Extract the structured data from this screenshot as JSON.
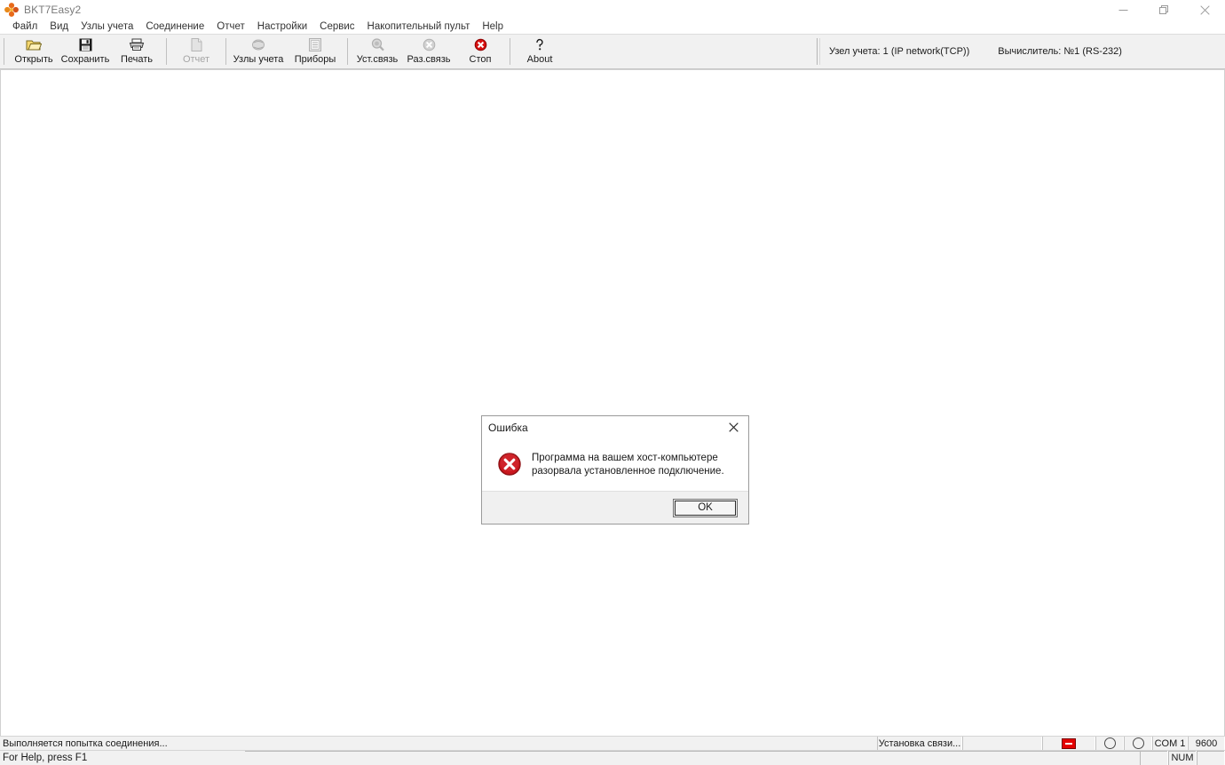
{
  "window": {
    "title": "BKT7Easy2",
    "app_icon": "clover-icon",
    "caption": {
      "minimize": "minimize-icon",
      "restore": "restore-icon",
      "close": "close-icon"
    }
  },
  "menubar": {
    "items": [
      {
        "label": "Файл",
        "name": "menu-file"
      },
      {
        "label": "Вид",
        "name": "menu-view"
      },
      {
        "label": "Узлы учета",
        "name": "menu-accounting-nodes"
      },
      {
        "label": "Соединение",
        "name": "menu-connection"
      },
      {
        "label": "Отчет",
        "name": "menu-report"
      },
      {
        "label": "Настройки",
        "name": "menu-settings"
      },
      {
        "label": "Сервис",
        "name": "menu-service"
      },
      {
        "label": "Накопительный пульт",
        "name": "menu-accumulator-console"
      },
      {
        "label": "Help",
        "name": "menu-help"
      }
    ]
  },
  "toolbar": {
    "buttons": [
      {
        "label": "Открыть",
        "icon": "open-folder-icon",
        "disabled": false
      },
      {
        "label": "Сохранить",
        "icon": "save-disk-icon",
        "disabled": false
      },
      {
        "label": "Печать",
        "icon": "print-icon",
        "disabled": false
      },
      {
        "label": "Отчет",
        "icon": "document-icon",
        "disabled": true
      },
      {
        "label": "Узлы учета",
        "icon": "nodes-icon",
        "disabled": true
      },
      {
        "label": "Приборы",
        "icon": "devices-icon",
        "disabled": true
      },
      {
        "label": "Уст.связь",
        "icon": "connect-search-icon",
        "disabled": true
      },
      {
        "label": "Раз.связь",
        "icon": "disconnect-icon",
        "disabled": true
      },
      {
        "label": "Стоп",
        "icon": "stop-icon",
        "disabled": false
      },
      {
        "label": "About",
        "icon": "about-icon",
        "disabled": false
      }
    ],
    "info_node": "Узел учета: 1   (IP network(TCP))",
    "info_computer": "Вычислитель: №1 (RS-232)"
  },
  "dialog": {
    "title": "Ошибка",
    "close_icon": "close-icon",
    "error_icon": "error-circle-x-icon",
    "message": "Программа на вашем хост-компьютере разорвала установленное подключение.",
    "ok_label": "OK"
  },
  "statusbar": {
    "progress_text": "Выполняется попытка соединения...",
    "connection_state": "Установка связи...",
    "led_indicator": "red-led-indicator",
    "circle_1": "tx-circle-indicator",
    "circle_2": "rx-circle-indicator",
    "port": "COM 1",
    "baud": "9600"
  },
  "statusbar2": {
    "hint": "For Help, press F1",
    "num_label": "NUM"
  },
  "colors": {
    "accent_red": "#e40000",
    "toolbar_bg": "#f1f1f1",
    "title_text": "#7a7a7a"
  }
}
